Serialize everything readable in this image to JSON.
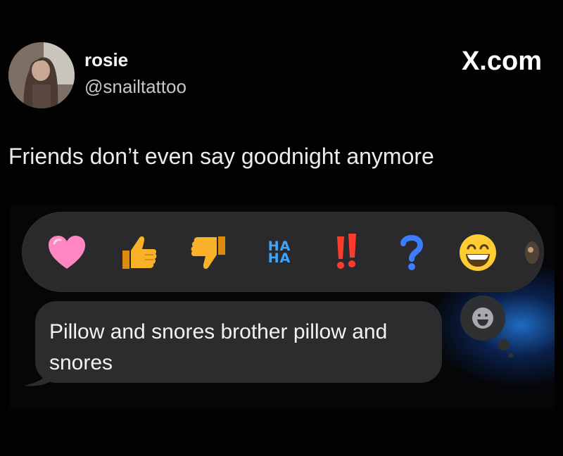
{
  "post": {
    "user_name": "rosie",
    "user_handle": "@snailtattoo",
    "brand": "X.com",
    "text": "Friends don’t even say goodnight anymore"
  },
  "screenshot": {
    "reactions": [
      {
        "icon": "heart-icon",
        "color": "#ff7fbf"
      },
      {
        "icon": "thumbs-up-icon",
        "color": "#f7a51f"
      },
      {
        "icon": "thumbs-down-icon",
        "color": "#f7a51f"
      },
      {
        "icon": "haha-icon",
        "label_line1": "HA",
        "label_line2": "HA",
        "color": "#3aa6ff"
      },
      {
        "icon": "exclamation-icon",
        "color": "#ff3b30"
      },
      {
        "icon": "question-icon",
        "color": "#3a7bff"
      },
      {
        "icon": "grinning-face-icon",
        "color": "#ffcc33"
      }
    ],
    "message": "Pillow and snores brother pillow and snores",
    "colors": {
      "background": "#020203",
      "reaction_bar": "#2a2a2c",
      "bubble": "#2c2c2e",
      "glow": "#2a8cff"
    }
  }
}
